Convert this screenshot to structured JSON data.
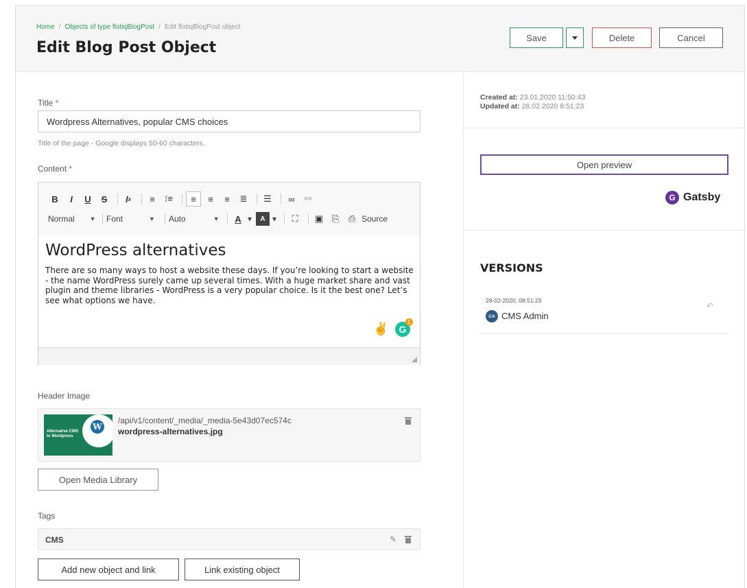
{
  "breadcrumb": [
    "Home",
    "Objects of type flotiqBlogPost",
    "Edit flotiqBlogPost object"
  ],
  "page_title": "Edit Blog Post Object",
  "actions": {
    "save": "Save",
    "delete": "Delete",
    "cancel": "Cancel"
  },
  "colors": {
    "accent": "#2d9a5a",
    "danger": "#d9534f",
    "preview_border": "#6e4ba0"
  },
  "form": {
    "title": {
      "label": "Title",
      "required_mark": "*",
      "value": "Wordpress Alternatives, popular CMS choices",
      "hint": "Title of the page - Google displays 50-60 characters."
    },
    "content": {
      "label": "Content",
      "required_mark": "*",
      "toolbar": {
        "row1": [
          "B",
          "I",
          "U",
          "S",
          "Ix",
          "ol",
          "ul",
          "align-left",
          "align-center",
          "align-right",
          "justify",
          "hr",
          "link",
          "unlink"
        ],
        "format": "Normal",
        "font": "Font",
        "size": "Auto",
        "source": "Source"
      },
      "heading": "WordPress alternatives",
      "body": "There are so many ways to host a website these days. If you’re looking to start a website - the name WordPress surely came up several times. With a huge market share and vast plugin and theme libraries - WordPress is a very popular choice. Is it the best one? Let’s see what options we have.",
      "grammarly_badge": "1"
    },
    "header_image": {
      "label": "Header Image",
      "path": "/api/v1/content/_media/_media-5e43d07ec574c",
      "filename": "wordpress-alternatives.jpg",
      "thumb_text": "Alternative CMS to Wordpress",
      "open_library": "Open Media Library"
    },
    "tags": {
      "label": "Tags",
      "items": [
        "CMS"
      ],
      "add_new": "Add new object and link",
      "link_existing": "Link existing object"
    }
  },
  "sidebar": {
    "created_label": "Created at:",
    "created_value": "23.01.2020 11:50:43",
    "updated_label": "Updated at:",
    "updated_value": "28.02.2020 8:51:23",
    "open_preview": "Open preview",
    "gatsby": "Gatsby",
    "versions_title": "VERSIONS",
    "versions": [
      {
        "date": "28-02-2020, 08:51:23",
        "initials": "CA",
        "user": "CMS Admin"
      }
    ]
  }
}
